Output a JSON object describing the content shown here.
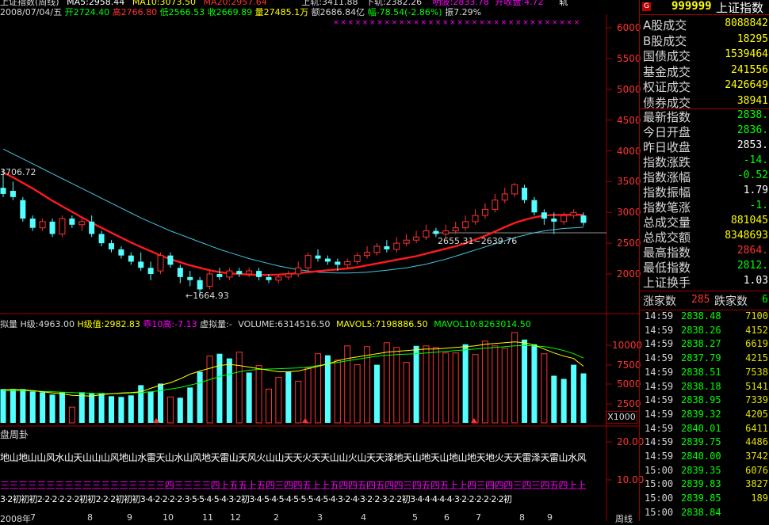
{
  "main_chart": {
    "title": "上证指数(周线)",
    "ma_labels": [
      {
        "text": "MA5:2958.44",
        "color": "#ffffff"
      },
      {
        "text": "MA10:3073.50",
        "color": "#ffff00"
      },
      {
        "text": "MA20:2957.64",
        "color": "#ff3232"
      }
    ],
    "info_line": {
      "date": "2008/07/04/五",
      "open": "开2724.40",
      "high": "高2766.80",
      "low": "低2566.53",
      "close": "收2669.89",
      "volume": "量27485.1万",
      "amount": "额2686.84亿",
      "change": "幅-78.54(-2.86%)",
      "amplitude": "振7.29%"
    },
    "top_right_fragments": [
      "上轨:3411.88",
      "下轨:2382.26",
      "明波:2833.78",
      "开收盘:4.72",
      "轨"
    ],
    "annotations": {
      "high_label": "3706.72",
      "low_label": "←1664.93",
      "range_label": "2655.31~2639.76"
    },
    "y_axis": [
      "6000",
      "5500",
      "5000",
      "4500",
      "4000",
      "3500",
      "3000",
      "2500",
      "2000"
    ]
  },
  "volume_panel": {
    "header": "拟量 H级:4963.00 H级值:2982.83 乖10高:-7.13 虚拟量:- VOLUME:6314516.50 MAVOL5:7198886.50 MAVOL10:8263014.50",
    "header_parts": [
      {
        "text": "拟量",
        "color": "#d8d8d8"
      },
      {
        "text": "H级:4963.00",
        "color": "#d8d8d8"
      },
      {
        "text": "H级值:2982.83",
        "color": "#ffff00"
      },
      {
        "text": "乖10高:-7.13",
        "color": "#ff00ff"
      },
      {
        "text": "虚拟量:-",
        "color": "#d8d8d8"
      },
      {
        "text": "VOLUME:6314516.50",
        "color": "#d8d8d8"
      },
      {
        "text": "MAVOL5:7198886.50",
        "color": "#ffff00"
      },
      {
        "text": "MAVOL10:8263014.50",
        "color": "#00ff00"
      }
    ],
    "y_axis": [
      "10000",
      "7500",
      "5000",
      "2500"
    ],
    "unit": "X1000"
  },
  "gua_panel": {
    "header": "盘周卦",
    "y_axis": [
      "20.00",
      "10.00"
    ],
    "row1": "地山地山山风水山天山山山风地山水雷天山水山风地天雷山天风火山山天天火天天山山火山天天泽地天山地天山地山地天地火天天雷泽天雷山水风地天雷山",
    "row2": "三三三三三三三三三三三三三三三三三三四三三三三四上五五上五四三四四五上上五四四五四五四四三四五四五上上四三四四四三四三四五四上上上四四四四四",
    "row3": "3·2初初初2·2·2·2·2·2初初2·2·2初初初3·4·2·2·2·2·3·5·5·4·5·4·3·2初3·4·5·4·5·4·5·5·5·4·5·4·3·2·4·3·2·2·3·2·2初3·4·4·4·4·4·3·2·2·2·2·2·2初",
    "date_axis": [
      "2008年",
      "7",
      "8",
      "9",
      "10",
      "11",
      "12",
      "2",
      "3",
      "4",
      "5",
      "6",
      "7",
      "8",
      "9"
    ],
    "period_label": "周线"
  },
  "chart_data": [
    {
      "type": "candlestick",
      "title": "上证指数(周线)",
      "ylim": [
        1600,
        6200
      ],
      "candles": [
        {
          "o": 3400,
          "c": 3300,
          "h": 3706,
          "l": 3250
        },
        {
          "o": 3350,
          "c": 3250,
          "h": 3500,
          "l": 3200
        },
        {
          "o": 3200,
          "c": 2900,
          "h": 3250,
          "l": 2850
        },
        {
          "o": 2900,
          "c": 2750,
          "h": 2950,
          "l": 2700
        },
        {
          "o": 2750,
          "c": 2850,
          "h": 2900,
          "l": 2700
        },
        {
          "o": 2850,
          "c": 2650,
          "h": 2900,
          "l": 2600
        },
        {
          "o": 2650,
          "c": 2900,
          "h": 2950,
          "l": 2600
        },
        {
          "o": 2900,
          "c": 2800,
          "h": 2950,
          "l": 2750
        },
        {
          "o": 2800,
          "c": 2850,
          "h": 2900,
          "l": 2700
        },
        {
          "o": 2850,
          "c": 2650,
          "h": 2950,
          "l": 2600
        },
        {
          "o": 2650,
          "c": 2500,
          "h": 2700,
          "l": 2450
        },
        {
          "o": 2500,
          "c": 2400,
          "h": 2550,
          "l": 2350
        },
        {
          "o": 2400,
          "c": 2300,
          "h": 2450,
          "l": 2250
        },
        {
          "o": 2300,
          "c": 2200,
          "h": 2350,
          "l": 2150
        },
        {
          "o": 2200,
          "c": 2100,
          "h": 2350,
          "l": 2050
        },
        {
          "o": 2100,
          "c": 2000,
          "h": 2200,
          "l": 1900
        },
        {
          "o": 2050,
          "c": 2300,
          "h": 2350,
          "l": 2000
        },
        {
          "o": 2300,
          "c": 2150,
          "h": 2350,
          "l": 2100
        },
        {
          "o": 2100,
          "c": 1950,
          "h": 2150,
          "l": 1850
        },
        {
          "o": 1950,
          "c": 1900,
          "h": 2050,
          "l": 1800
        },
        {
          "o": 1900,
          "c": 1750,
          "h": 1950,
          "l": 1664
        },
        {
          "o": 1800,
          "c": 2000,
          "h": 2050,
          "l": 1750
        },
        {
          "o": 2000,
          "c": 1950,
          "h": 2100,
          "l": 1900
        },
        {
          "o": 1950,
          "c": 2050,
          "h": 2100,
          "l": 1900
        },
        {
          "o": 2050,
          "c": 2000,
          "h": 2100,
          "l": 1950
        },
        {
          "o": 2000,
          "c": 2050,
          "h": 2100,
          "l": 1950
        },
        {
          "o": 2050,
          "c": 1950,
          "h": 2100,
          "l": 1900
        },
        {
          "o": 1950,
          "c": 1900,
          "h": 2000,
          "l": 1850
        },
        {
          "o": 1900,
          "c": 1950,
          "h": 2000,
          "l": 1850
        },
        {
          "o": 1950,
          "c": 2000,
          "h": 2050,
          "l": 1900
        },
        {
          "o": 2000,
          "c": 2100,
          "h": 2200,
          "l": 1950
        },
        {
          "o": 2100,
          "c": 2300,
          "h": 2350,
          "l": 2050
        },
        {
          "o": 2300,
          "c": 2250,
          "h": 2400,
          "l": 2200
        },
        {
          "o": 2250,
          "c": 2200,
          "h": 2300,
          "l": 2150
        },
        {
          "o": 2200,
          "c": 2150,
          "h": 2250,
          "l": 2050
        },
        {
          "o": 2150,
          "c": 2200,
          "h": 2250,
          "l": 2100
        },
        {
          "o": 2200,
          "c": 2300,
          "h": 2350,
          "l": 2150
        },
        {
          "o": 2300,
          "c": 2350,
          "h": 2450,
          "l": 2250
        },
        {
          "o": 2350,
          "c": 2450,
          "h": 2500,
          "l": 2300
        },
        {
          "o": 2450,
          "c": 2400,
          "h": 2550,
          "l": 2350
        },
        {
          "o": 2400,
          "c": 2500,
          "h": 2600,
          "l": 2350
        },
        {
          "o": 2500,
          "c": 2550,
          "h": 2650,
          "l": 2450
        },
        {
          "o": 2550,
          "c": 2600,
          "h": 2700,
          "l": 2500
        },
        {
          "o": 2600,
          "c": 2700,
          "h": 2800,
          "l": 2550
        },
        {
          "o": 2700,
          "c": 2650,
          "h": 2750,
          "l": 2600
        },
        {
          "o": 2650,
          "c": 2700,
          "h": 2800,
          "l": 2600
        },
        {
          "o": 2700,
          "c": 2750,
          "h": 2850,
          "l": 2650
        },
        {
          "o": 2750,
          "c": 2850,
          "h": 2950,
          "l": 2700
        },
        {
          "o": 2850,
          "c": 2950,
          "h": 3050,
          "l": 2800
        },
        {
          "o": 2950,
          "c": 3050,
          "h": 3150,
          "l": 2900
        },
        {
          "o": 3050,
          "c": 3200,
          "h": 3300,
          "l": 3000
        },
        {
          "o": 3200,
          "c": 3300,
          "h": 3400,
          "l": 3150
        },
        {
          "o": 3300,
          "c": 3450,
          "h": 3478,
          "l": 3250
        },
        {
          "o": 3400,
          "c": 3200,
          "h": 3450,
          "l": 3150
        },
        {
          "o": 3200,
          "c": 3000,
          "h": 3250,
          "l": 2950
        },
        {
          "o": 3000,
          "c": 2900,
          "h": 3050,
          "l": 2800
        },
        {
          "o": 2900,
          "c": 2850,
          "h": 3000,
          "l": 2650
        },
        {
          "o": 2850,
          "c": 2950,
          "h": 3000,
          "l": 2800
        },
        {
          "o": 2950,
          "c": 3000,
          "h": 3050,
          "l": 2900
        },
        {
          "o": 2950,
          "c": 2830,
          "h": 3000,
          "l": 2780
        }
      ],
      "ma_red": [
        3650,
        3570,
        3480,
        3390,
        3290,
        3190,
        3100,
        3010,
        2920,
        2830,
        2750,
        2670,
        2590,
        2510,
        2440,
        2370,
        2300,
        2240,
        2190,
        2140,
        2100,
        2060,
        2030,
        2010,
        2000,
        1990,
        1985,
        1985,
        1990,
        2000,
        2015,
        2030,
        2045,
        2060,
        2075,
        2090,
        2110,
        2140,
        2170,
        2200,
        2230,
        2260,
        2290,
        2330,
        2370,
        2410,
        2450,
        2500,
        2560,
        2620,
        2690,
        2760,
        2830,
        2880,
        2920,
        2950,
        2960,
        2960,
        2965,
        2960
      ],
      "ma_cyan": [
        4030,
        3950,
        3870,
        3790,
        3710,
        3630,
        3550,
        3470,
        3390,
        3310,
        3230,
        3150,
        3070,
        2990,
        2910,
        2840,
        2770,
        2700,
        2640,
        2580,
        2520,
        2460,
        2400,
        2350,
        2300,
        2250,
        2210,
        2170,
        2130,
        2100,
        2070,
        2050,
        2030,
        2020,
        2015,
        2015,
        2020,
        2030,
        2045,
        2060,
        2080,
        2100,
        2130,
        2160,
        2200,
        2240,
        2290,
        2340,
        2390,
        2440,
        2490,
        2540,
        2590,
        2630,
        2670,
        2700,
        2720,
        2740,
        2750,
        2760
      ]
    },
    {
      "type": "bar",
      "title": "VOLUME",
      "ylim": [
        0,
        12500
      ],
      "values": [
        4300,
        4300,
        4300,
        4000,
        3900,
        3600,
        3900,
        2000,
        3900,
        3800,
        3800,
        3400,
        3300,
        3500,
        4800,
        4000,
        5000,
        3300,
        3200,
        4500,
        6500,
        8500,
        8800,
        8200,
        9000,
        6400,
        7300,
        4300,
        5800,
        6500,
        5300,
        7000,
        8800,
        8600,
        8000,
        9800,
        7400,
        9700,
        7400,
        10200,
        9600,
        7700,
        9800,
        9800,
        9600,
        8900,
        8900,
        10000,
        8700,
        10400,
        9800,
        9500,
        11500,
        10600,
        10000,
        8800,
        6000,
        5600,
        7400,
        6300
      ],
      "filled": [
        1,
        1,
        1,
        1,
        1,
        1,
        1,
        0,
        1,
        1,
        1,
        1,
        1,
        1,
        1,
        1,
        1,
        0,
        1,
        1,
        1,
        0,
        1,
        1,
        0,
        1,
        0,
        0,
        0,
        1,
        0,
        0,
        0,
        1,
        0,
        0,
        0,
        0,
        1,
        0,
        0,
        0,
        1,
        0,
        0,
        0,
        0,
        1,
        0,
        0,
        0,
        0,
        0,
        1,
        1,
        0,
        1,
        1,
        1,
        1
      ],
      "mavol5": [
        4200,
        4250,
        4200,
        4100,
        3950,
        3800,
        3700,
        3500,
        3450,
        3400,
        3600,
        3700,
        3800,
        3850,
        3950,
        4400,
        4800,
        5100,
        5600,
        6200,
        6600,
        6950,
        7300,
        7450,
        7300,
        7100,
        6900,
        6700,
        6500,
        6500,
        6600,
        6900,
        7200,
        7500,
        7900,
        8200,
        8400,
        8600,
        8800,
        9000,
        9100,
        9200,
        9300,
        9400,
        9400,
        9500,
        9600,
        9700,
        9800,
        10000,
        10100,
        10200,
        10300,
        10200,
        9900,
        9400,
        8900,
        8500,
        8200,
        7200
      ],
      "mavol10": [
        4100,
        4120,
        4100,
        4050,
        4000,
        3950,
        3900,
        3850,
        3800,
        3750,
        3700,
        3700,
        3750,
        3800,
        3850,
        3950,
        4100,
        4300,
        4500,
        4800,
        5100,
        5500,
        5900,
        6200,
        6500,
        6700,
        6800,
        6850,
        6900,
        6950,
        7000,
        7100,
        7300,
        7500,
        7700,
        7900,
        8100,
        8300,
        8500,
        8600,
        8700,
        8750,
        8800,
        8900,
        9000,
        9100,
        9200,
        9300,
        9400,
        9500,
        9600,
        9700,
        9800,
        9850,
        9800,
        9700,
        9500,
        9200,
        8800,
        8260
      ]
    }
  ],
  "side_panel": {
    "header_code": "999999",
    "header_name": "上证指数",
    "stats": [
      {
        "label": "A股成交",
        "value": "8088842",
        "color": "#ffff00"
      },
      {
        "label": "B股成交",
        "value": "18295",
        "color": "#ffff00"
      },
      {
        "label": "国债成交",
        "value": "1539464",
        "color": "#ffff00"
      },
      {
        "label": "基金成交",
        "value": "241556",
        "color": "#ffff00"
      },
      {
        "label": "权证成交",
        "value": "2426649",
        "color": "#ffff00"
      },
      {
        "label": "债券成交",
        "value": "38941",
        "color": "#ffff00"
      }
    ],
    "index_stats": [
      {
        "label": "最新指数",
        "value": "2838.",
        "color": "#00ff00"
      },
      {
        "label": "今日开盘",
        "value": "2836.",
        "color": "#00ff00"
      },
      {
        "label": "昨日收盘",
        "value": "2853.",
        "color": "#ffffff"
      },
      {
        "label": "指数涨跌",
        "value": "-14.",
        "color": "#00ff00"
      },
      {
        "label": "指数涨幅",
        "value": "-0.52",
        "color": "#00ff00"
      },
      {
        "label": "指数振幅",
        "value": "1.79",
        "color": "#ffffff"
      },
      {
        "label": "指数笔涨",
        "value": "-1.",
        "color": "#00ff00"
      },
      {
        "label": "总成交量",
        "value": "881045",
        "color": "#ffff00"
      },
      {
        "label": "总成交额",
        "value": "8348693",
        "color": "#ffff00"
      },
      {
        "label": "最高指数",
        "value": "2864.",
        "color": "#ff3232"
      },
      {
        "label": "最低指数",
        "value": "2812.",
        "color": "#00ff00"
      },
      {
        "label": "上证换手",
        "value": "1.03",
        "color": "#ffffff"
      }
    ],
    "updown": {
      "up_label": "涨家数",
      "up_value": "285",
      "down_label": "跌家数",
      "down_value": "6"
    },
    "ticks": [
      {
        "time": "14:59",
        "price": "2838.48",
        "vol": "7100"
      },
      {
        "time": "14:59",
        "price": "2838.26",
        "vol": "4152"
      },
      {
        "time": "14:59",
        "price": "2838.27",
        "vol": "6619"
      },
      {
        "time": "14:59",
        "price": "2837.79",
        "vol": "4215"
      },
      {
        "time": "14:59",
        "price": "2838.51",
        "vol": "7538"
      },
      {
        "time": "14:59",
        "price": "2838.18",
        "vol": "5141"
      },
      {
        "time": "14:59",
        "price": "2838.95",
        "vol": "7339"
      },
      {
        "time": "14:59",
        "price": "2839.32",
        "vol": "4205"
      },
      {
        "time": "14:59",
        "price": "2840.01",
        "vol": "6411"
      },
      {
        "time": "14:59",
        "price": "2839.75",
        "vol": "4486"
      },
      {
        "time": "14:59",
        "price": "2840.00",
        "vol": "3742"
      },
      {
        "time": "15:00",
        "price": "2839.35",
        "vol": "6076"
      },
      {
        "time": "15:00",
        "price": "2839.83",
        "vol": "3827"
      },
      {
        "time": "15:00",
        "price": "2839.85",
        "vol": "189"
      },
      {
        "time": "15:00",
        "price": "2838.84",
        "vol": ""
      }
    ]
  }
}
